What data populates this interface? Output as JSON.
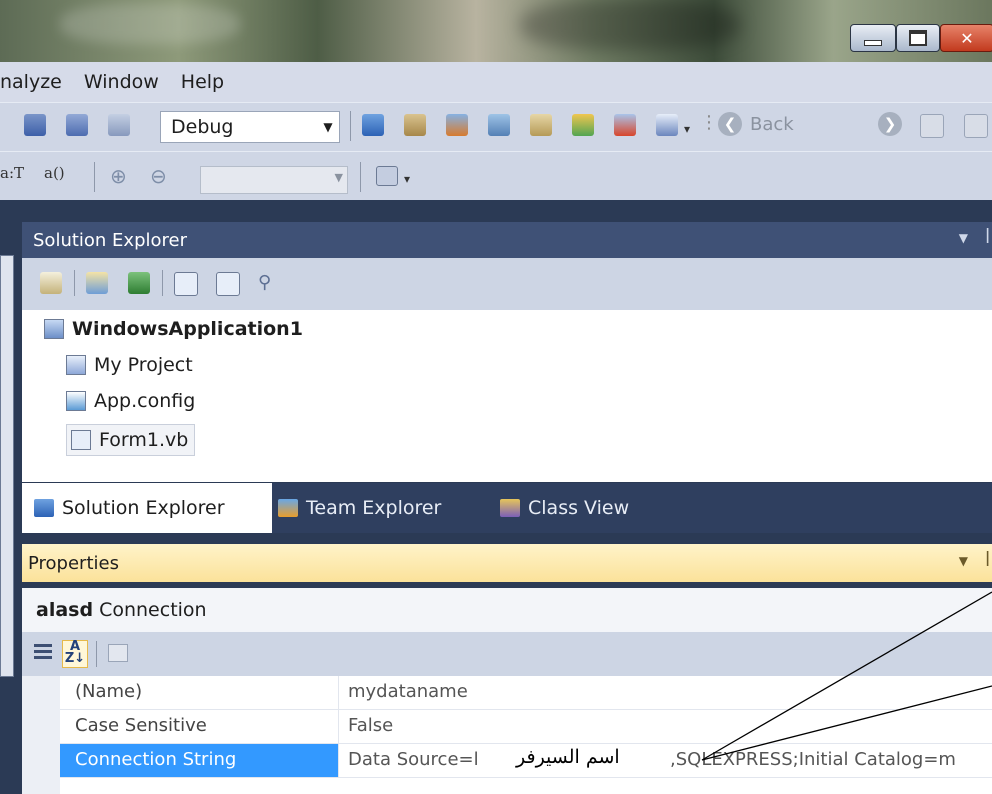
{
  "menu": {
    "items": [
      "nalyze",
      "Window",
      "Help"
    ]
  },
  "toolbar": {
    "config_value": "Debug",
    "back_label": "Back"
  },
  "toolbar2": {
    "text_items": [
      "a:T",
      "a()"
    ]
  },
  "solution_explorer": {
    "title": "Solution Explorer",
    "tree": {
      "root": "WindowsApplication1",
      "items": [
        "My Project",
        "App.config",
        "Form1.vb"
      ]
    },
    "tabs": [
      "Solution Explorer",
      "Team Explorer",
      "Class View"
    ]
  },
  "properties": {
    "title": "Properties",
    "object_name": "alasd",
    "object_type": "Connection",
    "rows": [
      {
        "name": "(Name)",
        "value": "mydataname"
      },
      {
        "name": "Case Sensitive",
        "value": "False"
      },
      {
        "name": "Connection String",
        "value_prefix": "Data Source=l",
        "value_suffix": ",SQLEXPRESS;Initial Catalog=m"
      }
    ]
  },
  "annotation": {
    "label": "اسم السيرفر"
  },
  "colors": {
    "header_dark": "#3f5176",
    "selected_row": "#3399ff",
    "properties_header": "#fbe29a",
    "toolbar_bg": "#cfd6e5"
  }
}
